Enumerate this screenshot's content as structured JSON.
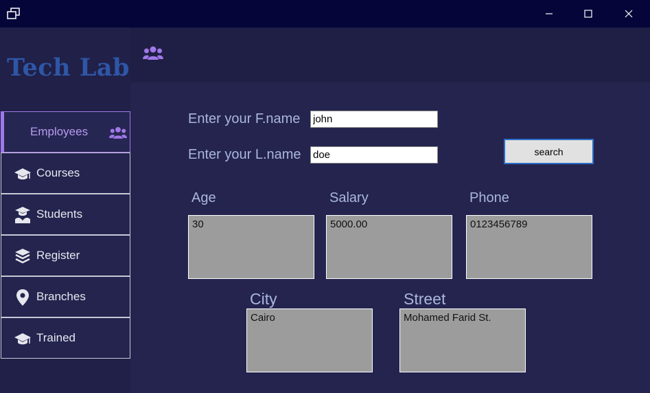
{
  "window": {
    "minimize_symbol": "—",
    "maximize_symbol": "☐",
    "close_symbol": "✕"
  },
  "app": {
    "logo": "Tech Lab",
    "accent": "#a078e8",
    "brand": "#2f56a6"
  },
  "header": {
    "icon": "users-icon"
  },
  "sidebar": {
    "items": [
      {
        "label": "Employees",
        "icon": "users-icon",
        "active": true
      },
      {
        "label": "Courses",
        "icon": "graduation-cap-icon"
      },
      {
        "label": "Students",
        "icon": "student-icon"
      },
      {
        "label": "Register",
        "icon": "layers-icon"
      },
      {
        "label": "Branches",
        "icon": "location-pin-icon"
      },
      {
        "label": "Trained",
        "icon": "graduation-cap-icon"
      }
    ]
  },
  "form": {
    "fname_label": "Enter your F.name",
    "fname_value": "john",
    "lname_label": "Enter your L.name",
    "lname_value": "doe",
    "search_label": "search"
  },
  "results": {
    "age_label": "Age",
    "age_value": "30",
    "salary_label": "Salary",
    "salary_value": "5000.00",
    "phone_label": "Phone",
    "phone_value": "0123456789",
    "city_label": "City",
    "city_value": "Cairo",
    "street_label": "Street",
    "street_value": "Mohamed Farid St."
  }
}
